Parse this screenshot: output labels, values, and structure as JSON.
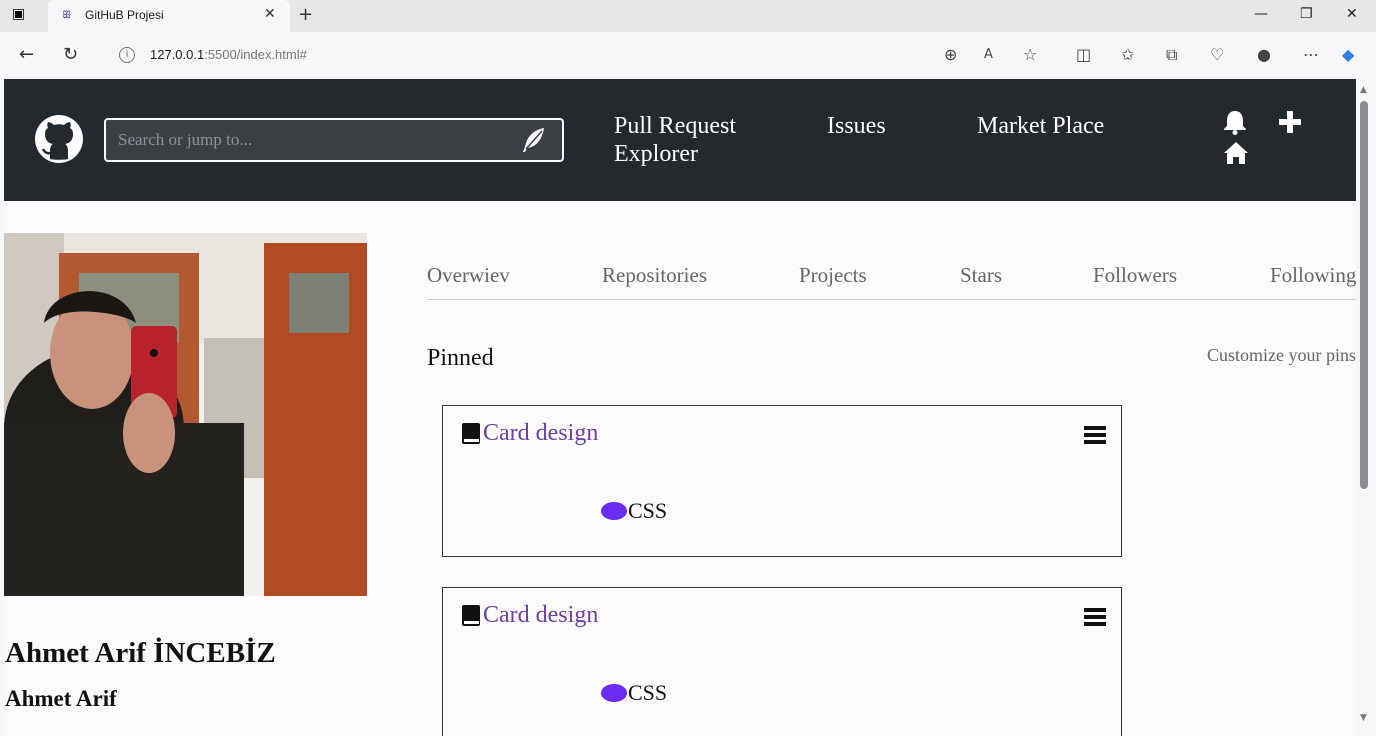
{
  "browser": {
    "tab_title": "GitHuB Projesi",
    "tab_favicon": "ꕥ",
    "url_host": "127.0.0.1",
    "url_rest": ":5500/index.html#"
  },
  "header": {
    "search_placeholder": "Search or jump to...",
    "nav": {
      "pull_request": "Pull Request",
      "explorer": "Explorer",
      "issues": "Issues",
      "market_place": "Market Place"
    },
    "icons": [
      "github-logo",
      "feather-icon",
      "bell-icon",
      "plus-icon",
      "home-icon"
    ]
  },
  "profile": {
    "full_name": "Ahmet Arif İNCEBİZ",
    "username": "Ahmet Arif"
  },
  "profile_tabs": [
    "Overwiev",
    "Repositories",
    "Projects",
    "Stars",
    "Followers",
    "Following"
  ],
  "pinned": {
    "title": "Pinned",
    "customize_label": "Customize your pins",
    "cards": [
      {
        "name": "Card design",
        "language": "CSS",
        "language_color": "#6b2bf0"
      },
      {
        "name": "Card design",
        "language": "CSS",
        "language_color": "#6b2bf0"
      }
    ]
  },
  "colors": {
    "header_bg": "#24292e",
    "repo_link": "#6f3fa3"
  }
}
